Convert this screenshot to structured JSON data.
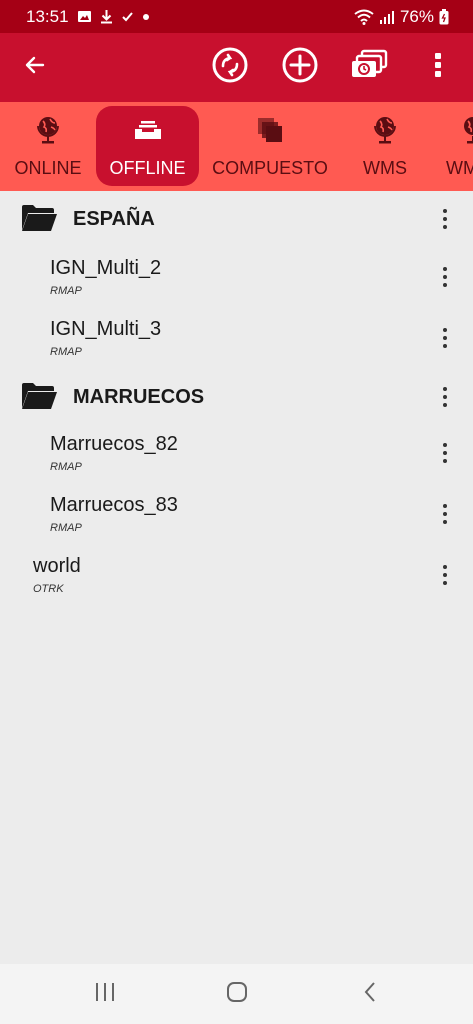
{
  "status_bar": {
    "time": "13:51",
    "battery": "76%",
    "icons": [
      "gallery-icon",
      "download-icon",
      "check-icon",
      "dot-icon",
      "wifi-icon",
      "signal-icon",
      "battery-icon"
    ]
  },
  "toolbar": {
    "icons": [
      "back-arrow-icon",
      "sync-icon",
      "add-circle-icon",
      "layers-stack-icon",
      "more-vert-icon"
    ]
  },
  "tabs": [
    {
      "label": "ONLINE",
      "icon": "globe-icon",
      "active": false
    },
    {
      "label": "OFFLINE",
      "icon": "inbox-tray-icon",
      "active": true
    },
    {
      "label": "COMPUESTO",
      "icon": "stacked-layers-icon",
      "active": false
    },
    {
      "label": "WMS",
      "icon": "globe-icon",
      "active": false
    },
    {
      "label": "WM",
      "icon": "globe-icon",
      "active": false
    }
  ],
  "list": {
    "folders": [
      {
        "name": "ESPAÑA",
        "items": [
          {
            "title": "IGN_Multi_2",
            "type": "RMAP"
          },
          {
            "title": "IGN_Multi_3",
            "type": "RMAP"
          }
        ]
      },
      {
        "name": "MARRUECOS",
        "items": [
          {
            "title": "Marruecos_82",
            "type": "RMAP"
          },
          {
            "title": "Marruecos_83",
            "type": "RMAP"
          }
        ]
      }
    ],
    "root_items": [
      {
        "title": "world",
        "type": "OTRK"
      }
    ]
  },
  "colors": {
    "status_bar": "#a50015",
    "toolbar": "#c8102e",
    "tab_strip": "#ff5a52",
    "tab_active": "#c8102e",
    "background": "#ececec"
  },
  "nav_bar": {
    "icons": [
      "recent-apps-icon",
      "home-icon",
      "back-icon"
    ]
  }
}
